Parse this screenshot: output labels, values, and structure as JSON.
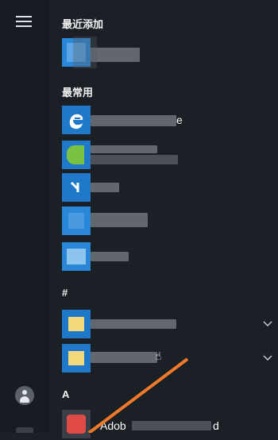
{
  "sections": {
    "recent": {
      "title": "最近添加"
    },
    "frequent": {
      "title": "最常用"
    },
    "hash": {
      "title": "#"
    },
    "a": {
      "title": "A"
    }
  },
  "rows": {
    "r5_label": "Adob",
    "r5_suffix": "d",
    "r1_suffix": "e"
  },
  "icons": {
    "menu": "hamburger-icon",
    "user": "user-account-icon",
    "expand": "chevron-down-icon"
  },
  "colors": {
    "background": "#1b1f26",
    "rail": "#181c22",
    "tile_blue": "#1f78c8",
    "folder_yellow": "#f5d87b",
    "annotation_arrow": "#f07a2a"
  }
}
